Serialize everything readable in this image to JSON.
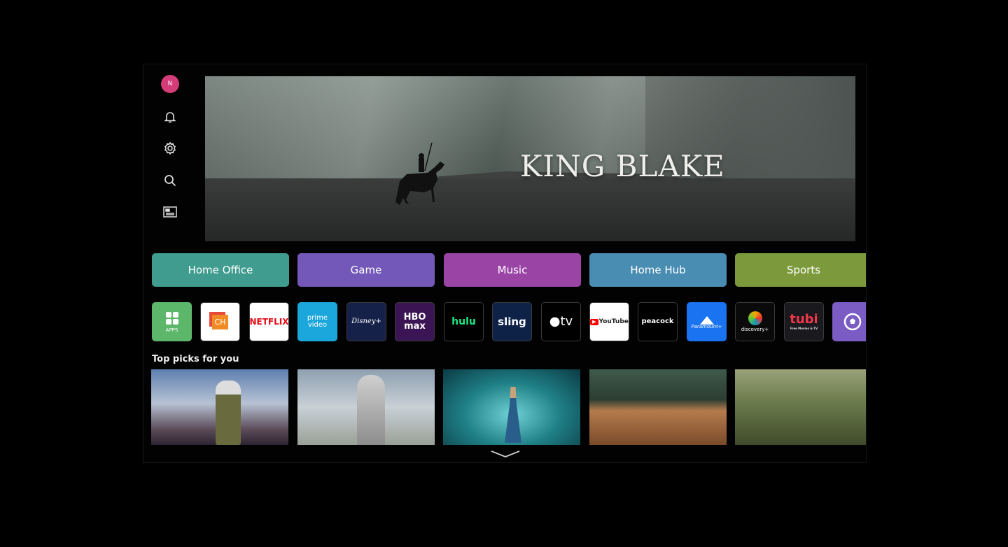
{
  "profile": {
    "initial": "N",
    "color": "#d43d77"
  },
  "sidebar": {
    "icons": [
      "bell-icon",
      "gear-icon",
      "search-icon",
      "guide-icon"
    ]
  },
  "hero": {
    "title": "KING BLAKE"
  },
  "categories": [
    {
      "label": "Home Office",
      "color": "#3f9c8f"
    },
    {
      "label": "Game",
      "color": "#7358b9"
    },
    {
      "label": "Music",
      "color": "#9a45a5"
    },
    {
      "label": "Home Hub",
      "color": "#4a8db3"
    },
    {
      "label": "Sports",
      "color": "#7c9a3c"
    }
  ],
  "apps": [
    {
      "name": "APPS",
      "bg": "#5db76b"
    },
    {
      "name": "CH",
      "bg": "#ffffff"
    },
    {
      "name": "NETFLIX",
      "bg": "#ffffff"
    },
    {
      "name": "prime video",
      "bg": "#1ca7dc"
    },
    {
      "name": "Disney+",
      "bg": "#16214a"
    },
    {
      "name": "HBO max",
      "bg": "#3b1553"
    },
    {
      "name": "hulu",
      "bg": "#000000"
    },
    {
      "name": "sling",
      "bg": "#0e2248"
    },
    {
      "name": "tv",
      "bg": "#000000"
    },
    {
      "name": "YouTube",
      "bg": "#ffffff"
    },
    {
      "name": "peacock",
      "bg": "#000000"
    },
    {
      "name": "Paramount+",
      "bg": "#1a73f0"
    },
    {
      "name": "discovery+",
      "bg": "#0a0a0a"
    },
    {
      "name": "tubi",
      "bg": "#1a1a1e",
      "subtitle": "Free Movies & TV"
    },
    {
      "name": "sports-app",
      "bg": "#7a5cc4"
    }
  ],
  "top_picks": {
    "label": "Top picks for you"
  }
}
